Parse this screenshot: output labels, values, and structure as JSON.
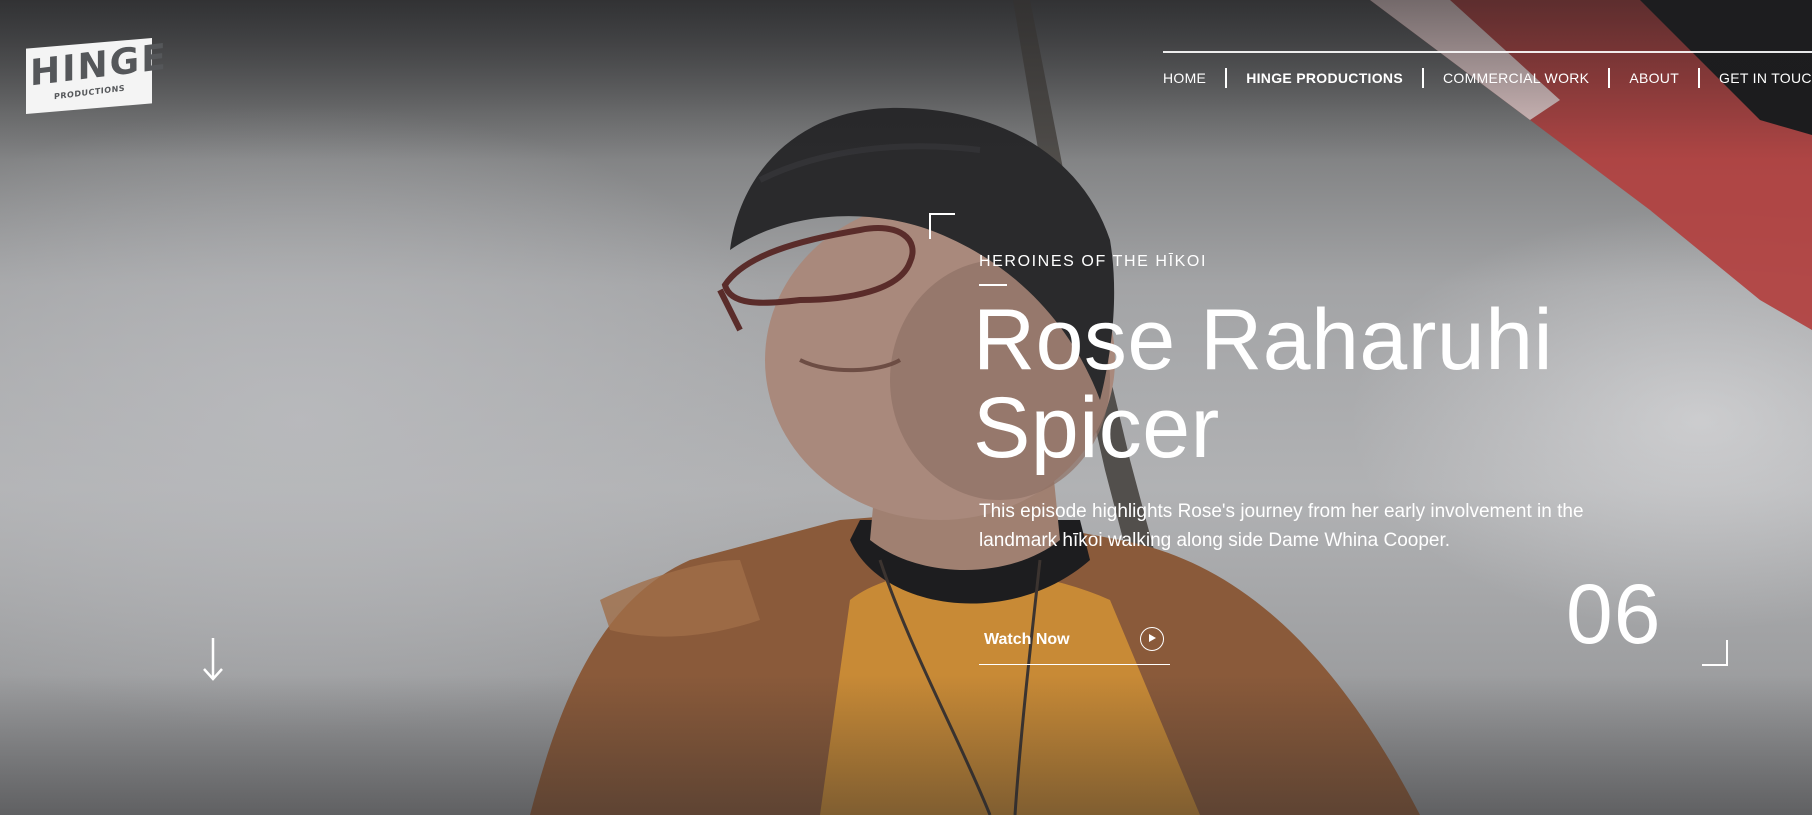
{
  "logo": {
    "wordmark": "HINGE",
    "sub": "PRODUCTIONS"
  },
  "nav": {
    "items": [
      {
        "label": "HOME"
      },
      {
        "label": "HINGE PRODUCTIONS",
        "active": true
      },
      {
        "label": "COMMERCIAL WORK"
      },
      {
        "label": "ABOUT"
      },
      {
        "label": "GET IN TOUCH"
      }
    ]
  },
  "hero": {
    "eyebrow": "HEROINES OF THE HĪKOI",
    "title_line1": "Rose Raharuhi",
    "title_line2": "Spicer",
    "description": "This episode highlights Rose's journey from her early involvement in the landmark hīkoi walking along side Dame Whina Cooper.",
    "watch_label": "Watch Now",
    "watch_icon": "play-circle-icon",
    "episode_number": "06",
    "scroll_icon": "arrow-down-icon"
  },
  "colors": {
    "text": "#ffffff",
    "flag_red": "#b2403f",
    "sweater": "#c88a36",
    "coat": "#8a5a3a",
    "beanie": "#2a2a2c"
  }
}
